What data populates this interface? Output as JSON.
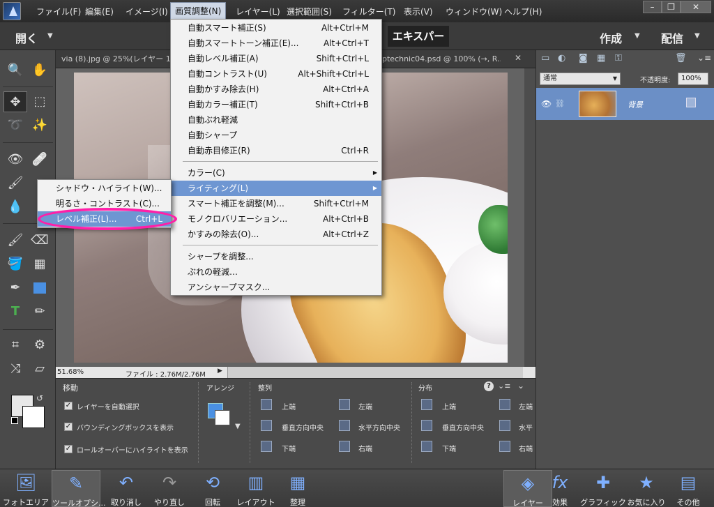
{
  "menubar": {
    "items": [
      "ファイル(F)",
      "編集(E)",
      "イメージ(I)",
      "画質調整(N)",
      "レイヤー(L)",
      "選択範囲(S)",
      "フィルター(T)",
      "表示(V)",
      "ウィンドウ(W)",
      "ヘルプ(H)"
    ],
    "active": "画質調整(N)",
    "window_buttons": [
      "–",
      "❐",
      "✕"
    ]
  },
  "modebar": {
    "open_label": "開く",
    "expert_label": "エキスパート",
    "create_label": "作成",
    "share_label": "配信"
  },
  "doc_tabs": {
    "tab1": "via (8).jpg @ 25%(レイヤー 1, R",
    "tab2": "ptechnic04.psd @ 100% (→, R..."
  },
  "statusbar": {
    "zoom": "51.68%",
    "file_info": "ファイル : 2.76M/2.76M"
  },
  "dropdown": {
    "items": [
      {
        "label": "自動スマート補正(S)",
        "shortcut": "Alt+Ctrl+M"
      },
      {
        "label": "自動スマートトーン補正(E)...",
        "shortcut": "Alt+Ctrl+T"
      },
      {
        "label": "自動レベル補正(A)",
        "shortcut": "Shift+Ctrl+L"
      },
      {
        "label": "自動コントラスト(U)",
        "shortcut": "Alt+Shift+Ctrl+L"
      },
      {
        "label": "自動かすみ除去(H)",
        "shortcut": "Alt+Ctrl+A"
      },
      {
        "label": "自動カラー補正(T)",
        "shortcut": "Shift+Ctrl+B"
      },
      {
        "label": "自動ぶれ軽減",
        "shortcut": ""
      },
      {
        "label": "自動シャープ",
        "shortcut": ""
      },
      {
        "label": "自動赤目修正(R)",
        "shortcut": "Ctrl+R"
      },
      {
        "label": "カラー(C)",
        "shortcut": ""
      },
      {
        "label": "ライティング(L)",
        "shortcut": ""
      },
      {
        "label": "スマート補正を調整(M)...",
        "shortcut": "Shift+Ctrl+M"
      },
      {
        "label": "モノクロバリエーション...",
        "shortcut": "Alt+Ctrl+B"
      },
      {
        "label": "かすみの除去(O)...",
        "shortcut": "Alt+Ctrl+Z"
      },
      {
        "label": "シャープを調整...",
        "shortcut": ""
      },
      {
        "label": "ぶれの軽減…",
        "shortcut": ""
      },
      {
        "label": "アンシャープマスク...",
        "shortcut": ""
      }
    ]
  },
  "submenu": {
    "items": [
      {
        "label": "シャドウ・ハイライト(W)...",
        "shortcut": ""
      },
      {
        "label": "明るさ・コントラスト(C)...",
        "shortcut": ""
      },
      {
        "label": "レベル補正(L)...",
        "shortcut": "Ctrl+L"
      }
    ]
  },
  "tool_options": {
    "title": "移動",
    "arrange_label": "アレンジ",
    "align_label": "整列",
    "distribute_label": "分布",
    "checkbox_auto_select": "レイヤーを自動選択",
    "checkbox_bounding_box": "バウンディングボックスを表示",
    "checkbox_rollover": "ロールオーバーにハイライトを表示",
    "align": {
      "top": "上端",
      "vcenter": "垂直方向中央",
      "bottom": "下端",
      "left": "左端",
      "hcenter": "水平方向中央",
      "right": "右端"
    },
    "distribute": {
      "top": "上端",
      "vcenter": "垂直方向中央",
      "bottom": "下端",
      "left": "左端",
      "hcenter": "水平",
      "right": "右端"
    }
  },
  "layers_panel": {
    "blend_mode": "通常",
    "opacity_label": "不透明度:",
    "opacity_value": "100%",
    "layer_name": "背景"
  },
  "bottombar": {
    "photo_area": "フォトエリア",
    "tool_options": "ツールオプシ...",
    "undo": "取り消し",
    "redo": "やり直し",
    "rotate": "回転",
    "layout": "レイアウト",
    "organize": "整理",
    "layers": "レイヤー",
    "effects": "効果",
    "graphics": "グラフィック",
    "favorites": "お気に入り",
    "more": "その他"
  },
  "colors": {
    "accent": "#6e96d2",
    "highlight_ellipse": "#ff1fa8"
  }
}
